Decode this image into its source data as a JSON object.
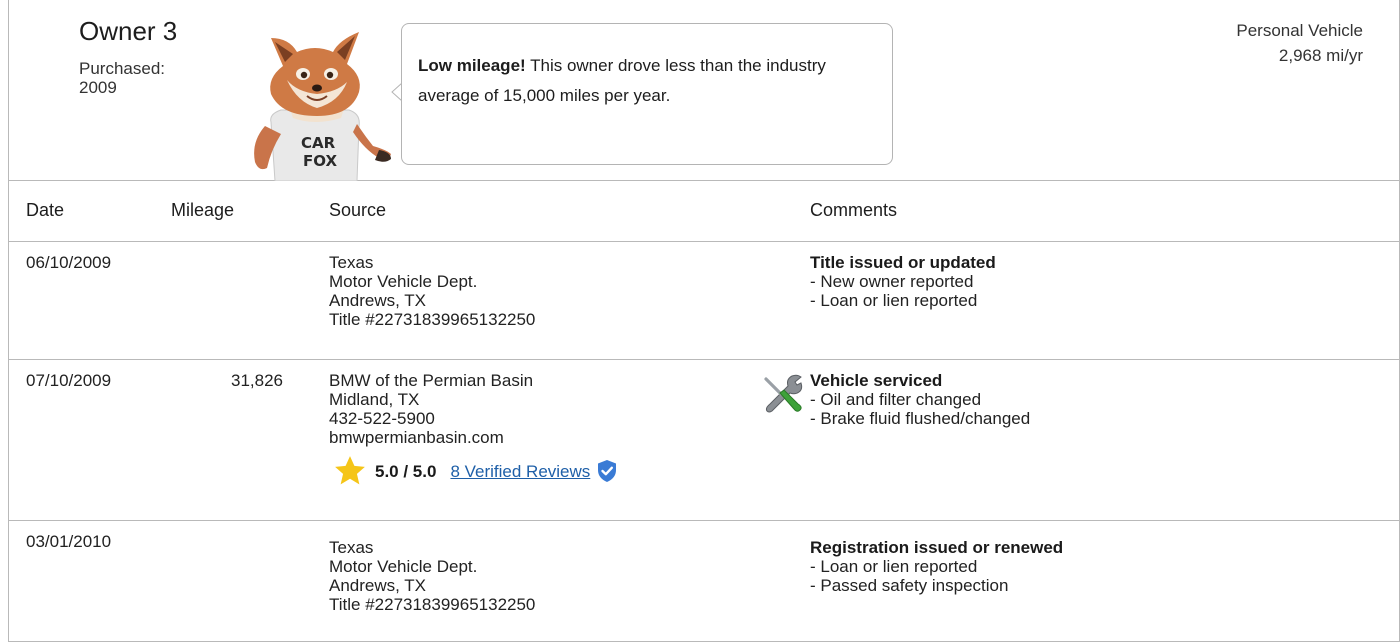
{
  "owner": {
    "title": "Owner 3",
    "purchased_label": "Purchased:",
    "purchased_year": "2009",
    "bubble_bold": "Low mileage!",
    "bubble_text": " This owner drove less than the industry average of 15,000 miles per year.",
    "vehicle_type": "Personal Vehicle",
    "annual_miles": "2,968 mi/yr",
    "mascot_shirt_line1": "CAR",
    "mascot_shirt_line2": "FOX"
  },
  "columns": {
    "date": "Date",
    "mileage": "Mileage",
    "source": "Source",
    "comments": "Comments"
  },
  "records": [
    {
      "date": "06/10/2009",
      "mileage": "",
      "source": [
        "Texas",
        "Motor Vehicle Dept.",
        "Andrews, TX",
        "Title #22731839965132250"
      ],
      "comment_title": "Title issued or updated",
      "comments": [
        "- New owner reported",
        "- Loan or lien reported"
      ]
    },
    {
      "date": "07/10/2009",
      "mileage": "31,826",
      "source": [
        "BMW of the Permian Basin",
        "Midland, TX",
        "432-522-5900",
        "bmwpermianbasin.com"
      ],
      "rating": "5.0 / 5.0",
      "reviews_link": "8 Verified Reviews",
      "comment_title": "Vehicle serviced",
      "comments": [
        "- Oil and filter changed",
        "- Brake fluid flushed/changed"
      ],
      "icon": "service-tools-icon"
    },
    {
      "date": "03/01/2010",
      "mileage": "",
      "source": [
        "Texas",
        "Motor Vehicle Dept.",
        "Andrews, TX",
        "Title #22731839965132250"
      ],
      "comment_title": "Registration issued or renewed",
      "comments": [
        "- Loan or lien reported",
        "- Passed safety inspection"
      ]
    }
  ],
  "colors": {
    "border": "#b9b9b9",
    "link": "#1e5fa8",
    "star": "#f5c518",
    "shield": "#3a7bd5"
  }
}
